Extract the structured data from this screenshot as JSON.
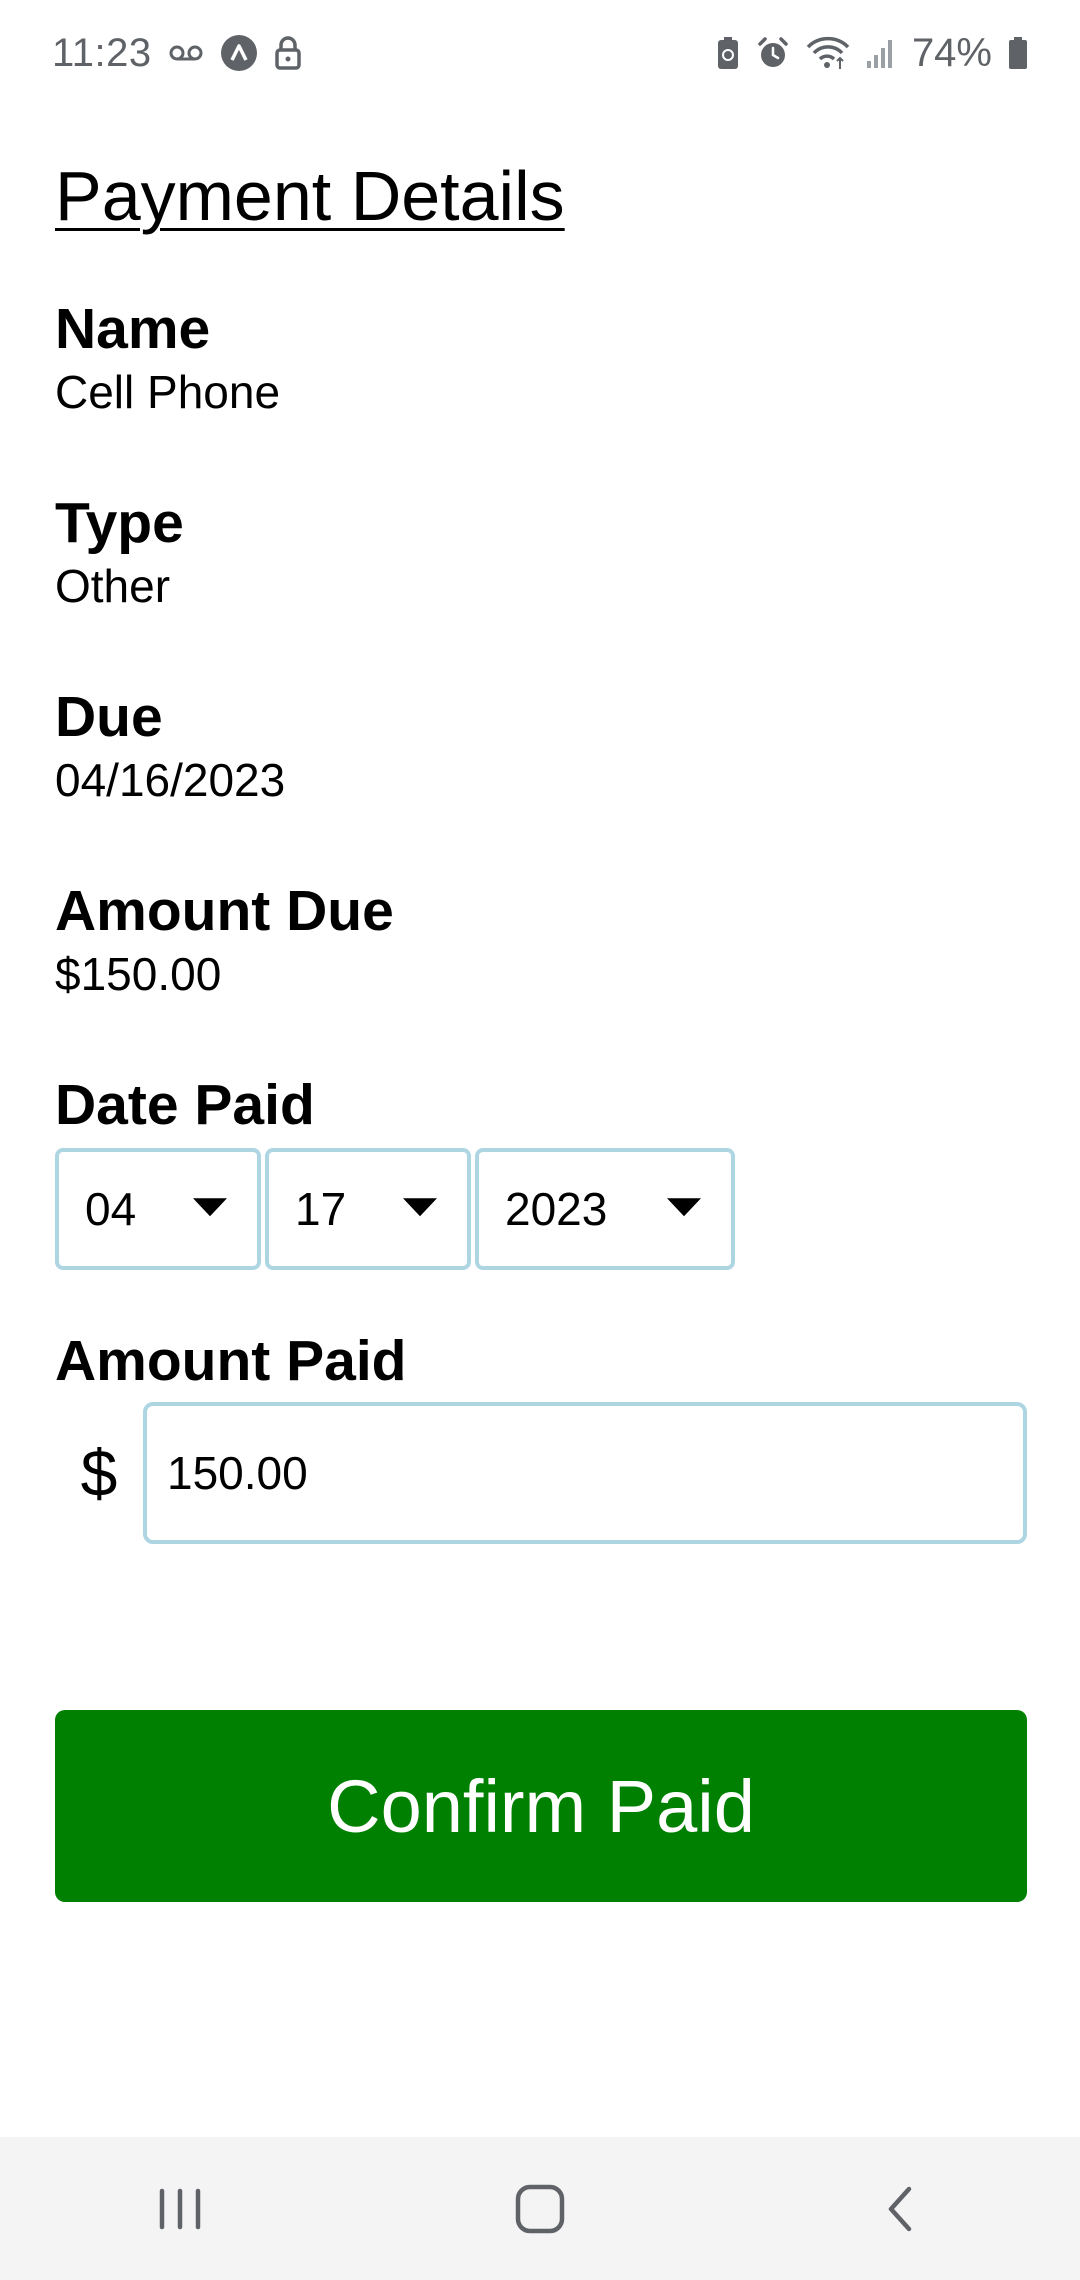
{
  "status_bar": {
    "time": "11:23",
    "battery_percent": "74%",
    "left_icons": [
      "voicemail-icon",
      "app-notification-icon",
      "lock-icon"
    ],
    "right_icons": [
      "battery-saver-icon",
      "alarm-icon",
      "wifi-icon",
      "signal-icon",
      "battery-icon"
    ]
  },
  "page": {
    "title": "Payment Details"
  },
  "fields": {
    "name": {
      "label": "Name",
      "value": "Cell Phone"
    },
    "type": {
      "label": "Type",
      "value": "Other"
    },
    "due": {
      "label": "Due",
      "value": "04/16/2023"
    },
    "amount_due": {
      "label": "Amount Due",
      "value": "$150.00"
    }
  },
  "date_paid": {
    "label": "Date Paid",
    "month": "04",
    "day": "17",
    "year": "2023"
  },
  "amount_paid": {
    "label": "Amount Paid",
    "currency": "$",
    "value": "150.00"
  },
  "actions": {
    "confirm_label": "Confirm Paid"
  },
  "colors": {
    "confirm_button": "#008000",
    "input_border": "#aed6e2",
    "nav_bar_bg": "#f4f4f4",
    "status_text": "#5f6368"
  },
  "nav_bar": {
    "buttons": [
      "recent-apps-icon",
      "home-icon",
      "back-icon"
    ]
  }
}
